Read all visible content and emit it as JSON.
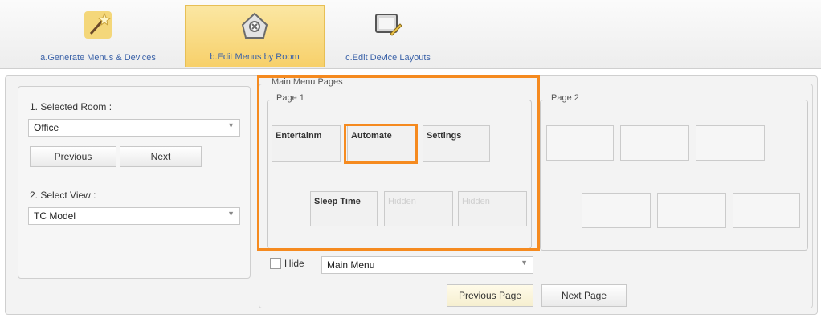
{
  "ribbon": {
    "tabs": [
      {
        "label": "a.Generate Menus & Devices",
        "icon": "magic-wand-icon"
      },
      {
        "label": "b.Edit Menus by Room",
        "icon": "room-settings-icon"
      },
      {
        "label": "c.Edit Device Layouts",
        "icon": "device-layout-icon"
      }
    ]
  },
  "left": {
    "selected_room_label": "1. Selected Room :",
    "room_value": "Office",
    "previous_label": "Previous",
    "next_label": "Next",
    "select_view_label": "2. Select View :",
    "view_value": "TC Model"
  },
  "main_menu": {
    "group_label": "Main Menu Pages",
    "page1_label": "Page 1",
    "page2_label": "Page 2",
    "page1_top": [
      "Entertainm",
      "Automate",
      "Settings"
    ],
    "page1_bottom": [
      "Sleep Time",
      "Hidden",
      "Hidden"
    ],
    "hide_label": "Hide",
    "menu_select_value": "Main Menu",
    "previous_page_label": "Previous Page",
    "next_page_label": "Next Page"
  },
  "colors": {
    "highlight": "#f58a1f",
    "ribbon_active": "#f7d06a",
    "ribbon_text": "#3b62a8"
  }
}
